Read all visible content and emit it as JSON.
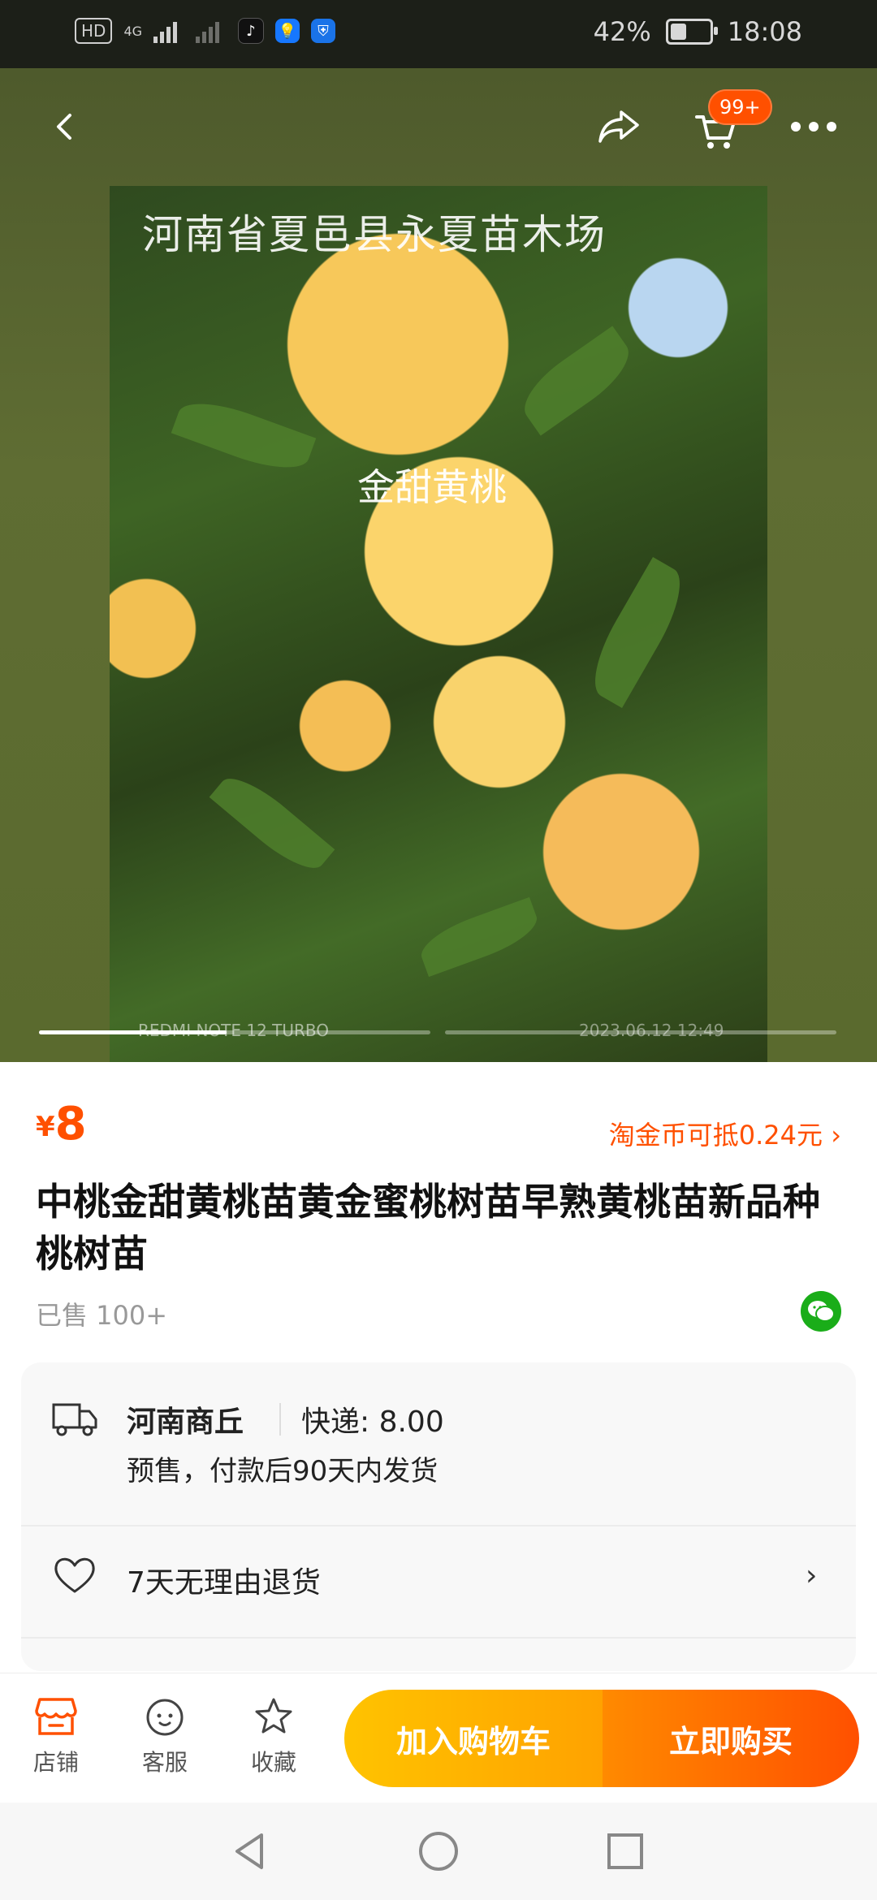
{
  "status_bar": {
    "hd_label": "HD",
    "network_label": "4G",
    "battery_percent": "42%",
    "battery_level": 0.42,
    "time": "18:08"
  },
  "topbar": {
    "icons": [
      "back-icon",
      "share-icon",
      "cart-icon",
      "more-icon"
    ],
    "cart_badge": "99+"
  },
  "gallery": {
    "overlay_text_top": "河南省夏邑县永夏苗木场",
    "overlay_text_mid": "金甜黄桃",
    "watermark_left": "REDMI NOTE 12 TURBO",
    "watermark_right": "2023.06.12  12:49",
    "progress": [
      0.48,
      0
    ]
  },
  "product": {
    "currency": "¥",
    "price": "8",
    "coin_offer": "淘金币可抵0.24元",
    "title": "中桃金甜黄桃苗黄金蜜桃树苗早熟黄桃苗新品种桃树苗",
    "sold": "已售 100+"
  },
  "shipping": {
    "origin": "河南商丘",
    "fee": "快递: 8.00",
    "note": "预售，付款后90天内发货"
  },
  "returns": {
    "label": "7天无理由退货"
  },
  "bottom_bar": {
    "store": "店铺",
    "service": "客服",
    "favorite": "收藏",
    "add_to_cart": "加入购物车",
    "buy_now": "立即购买"
  },
  "colors": {
    "accent": "#ff5000",
    "cart_button": "#ffb000",
    "wechat": "#1aad19"
  }
}
